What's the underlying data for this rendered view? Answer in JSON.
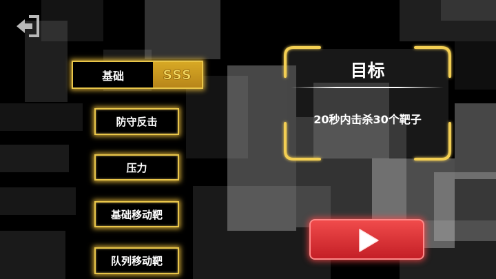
{
  "modes": [
    {
      "label": "基础",
      "grade": "SSS",
      "selected": true
    },
    {
      "label": "防守反击"
    },
    {
      "label": "压力"
    },
    {
      "label": "基础移动靶"
    },
    {
      "label": "队列移动靶"
    }
  ],
  "objective": {
    "title": "目标",
    "description": "20秒内击杀30个靶子"
  },
  "colors": {
    "gold": "#e9c64a",
    "play_red": "#e03a3e",
    "background": "#000000"
  },
  "icons": {
    "back": "exit-arrow-icon",
    "play": "play-triangle-icon"
  }
}
